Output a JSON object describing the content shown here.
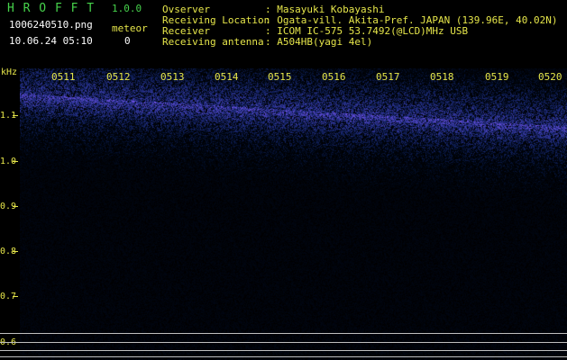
{
  "app": {
    "title": "H R O F F T",
    "version": "1.0.0",
    "filename": "1006240510.png",
    "datetime": "10.06.24 05:10",
    "meteor_label": "meteor",
    "meteor_count": "0"
  },
  "info": {
    "observer_label": "Ovserver",
    "observer_value": ": Masayuki Kobayashi",
    "location_label": "Receiving Location",
    "location_value": ": Ogata-vill. Akita-Pref. JAPAN (139.96E, 40.02N)",
    "receiver_label": "Receiver",
    "receiver_value": ": ICOM IC-575 53.7492(@LCD)MHz USB",
    "antenna_label": "Receiving antenna",
    "antenna_value": ": A504HB(yagi 4el)"
  },
  "axis": {
    "unit": "kHz",
    "ticks": [
      "1.1",
      "1.0",
      "0.9",
      "0.8",
      "0.7",
      "0.6"
    ]
  },
  "time_labels": [
    "0511",
    "0512",
    "0513",
    "0514",
    "0515",
    "0516",
    "0517",
    "0518",
    "0519",
    "0520"
  ],
  "colors": {
    "background": "#000000",
    "header_green": "#46d24b",
    "text_yellow": "#e6e64a",
    "signal_blue": "#2a3cff",
    "reference_line": "#bfbfbf"
  }
}
